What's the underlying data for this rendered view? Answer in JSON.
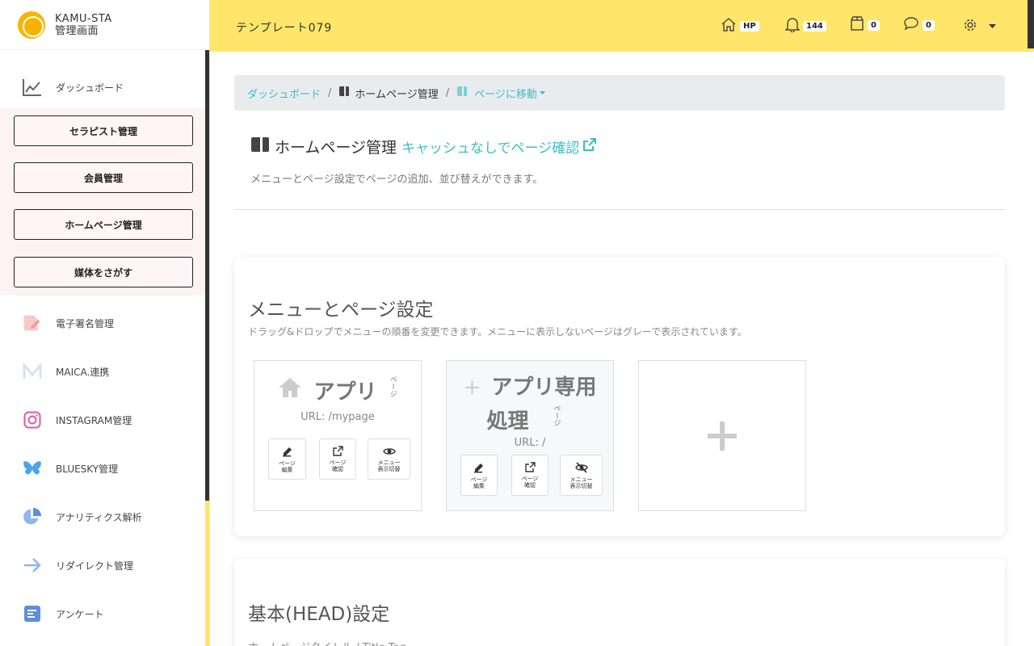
{
  "brand": {
    "line1": "KAMU-STA",
    "line2": "管理画面"
  },
  "sidebar": {
    "dashboard": "ダッシュボード",
    "sub_buttons": [
      "セラピスト管理",
      "会員管理",
      "ホームページ管理",
      "媒体をさがす"
    ],
    "items": [
      "電子署名管理",
      "MAICA.連携",
      "INSTAGRAM管理",
      "BLUESKY管理",
      "アナリティクス解析",
      "リダイレクト管理",
      "アンケート"
    ]
  },
  "header": {
    "title": "テンプレート079",
    "hp_badge": "HP",
    "notifications": "144",
    "box_count": "0",
    "messages": "0"
  },
  "breadcrumb": {
    "home": "ダッシュボード",
    "current": "ホームページ管理",
    "dropdown": "ページに移動"
  },
  "page": {
    "title": "ホームページ管理",
    "no_cache_link": "キャッシュなしでページ確認",
    "subtitle": "メニューとページ設定でページの追加、並び替えができます。"
  },
  "menu_section": {
    "heading": "メニューとページ設定",
    "desc": "ドラッグ&ドロップでメニューの順番を変更できます。メニューに表示しないページはグレーで表示されています。",
    "cards": [
      {
        "title": "アプリ",
        "kind": "ページ",
        "url": "URL: /mypage",
        "btn_edit": [
          "ページ",
          "編集"
        ],
        "btn_view": [
          "ページ",
          "確認"
        ],
        "btn_toggle": [
          "メニュー",
          "表示切替"
        ]
      },
      {
        "title_line1": "アプリ専用",
        "title_line2": "処理",
        "kind": "ページ",
        "url": "URL: /",
        "btn_edit": [
          "ページ",
          "編集"
        ],
        "btn_view": [
          "ページ",
          "確認"
        ],
        "btn_toggle": [
          "メニュー",
          "表示切替"
        ]
      }
    ]
  },
  "head_section": {
    "heading": "基本(HEAD)設定",
    "field_label": "ホームページタイトル / Title Tag"
  },
  "colors": {
    "accent": "#3bbec2",
    "header": "#ffe66a"
  }
}
